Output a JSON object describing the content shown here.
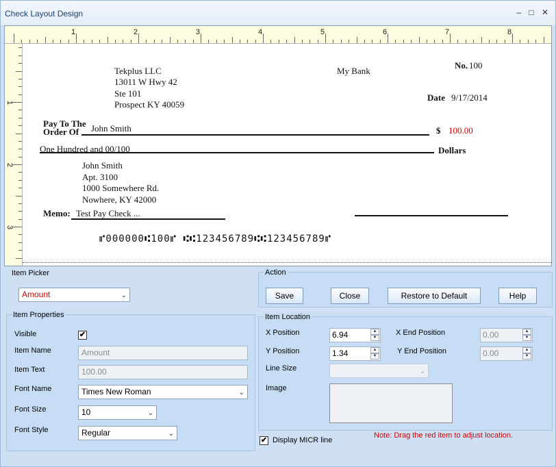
{
  "window": {
    "title": "Check Layout Design",
    "minimize_icon": "–",
    "maximize_icon": "□",
    "close_icon": "✕"
  },
  "ruler": {
    "h_numbers": [
      "1",
      "2",
      "3",
      "4",
      "5",
      "6",
      "7",
      "8"
    ],
    "v_numbers": [
      "1",
      "2",
      "3"
    ]
  },
  "check": {
    "company": [
      "Tekplus LLC",
      "13011 W Hwy 42",
      "Ste 101",
      "Prospect KY 40059"
    ],
    "bank_name": "My Bank",
    "no_label": "No.",
    "no_value": "100",
    "date_label": "Date",
    "date_value": "9/17/2014",
    "pay_to_line1": "Pay To The",
    "pay_to_line2": "Order Of",
    "payee": "John Smith",
    "dollar_sign": "$",
    "amount": "100.00",
    "amount_words": "One Hundred  and 00/100",
    "dollars_label": "Dollars",
    "address": [
      "John Smith",
      "Apt. 3100",
      "1000 Somewhere Rd.",
      "Nowhere, KY 42000"
    ],
    "memo_label": "Memo:",
    "memo_value": "Test Pay Check ...",
    "micr": "⑈000000⑆100⑈ ⑆⑆123456789⑆⑆123456789⑈"
  },
  "item_picker": {
    "label": "Item Picker",
    "selected": "Amount",
    "color": "#d00000"
  },
  "action": {
    "label": "Action",
    "save": "Save",
    "close": "Close",
    "restore": "Restore to Default",
    "help": "Help"
  },
  "item_properties": {
    "label": "Item Properties",
    "visible_label": "Visible",
    "visible_checked": true,
    "visible_mark": "✔",
    "name_label": "Item Name",
    "name_value": "Amount",
    "text_label": "Item Text",
    "text_value": "100.00",
    "font_name_label": "Font Name",
    "font_name_value": "Times New Roman",
    "font_size_label": "Font Size",
    "font_size_value": "10",
    "font_style_label": "Font Style",
    "font_style_value": "Regular"
  },
  "item_location": {
    "label": "Item Location",
    "x_label": "X Position",
    "x_value": "6.94",
    "x_end_label": "X End Position",
    "x_end_value": "0.00",
    "y_label": "Y Position",
    "y_value": "1.34",
    "y_end_label": "Y End Position",
    "y_end_value": "0.00",
    "line_size_label": "Line Size",
    "line_size_value": "",
    "image_label": "Image"
  },
  "micr_option": {
    "label": "Display MICR line",
    "checked": true,
    "mark": "✔"
  },
  "note": "Note:  Drag the red item to adjust location.",
  "icons": {
    "dropdown": "⌄",
    "spin_up": "▲",
    "spin_down": "▼"
  }
}
